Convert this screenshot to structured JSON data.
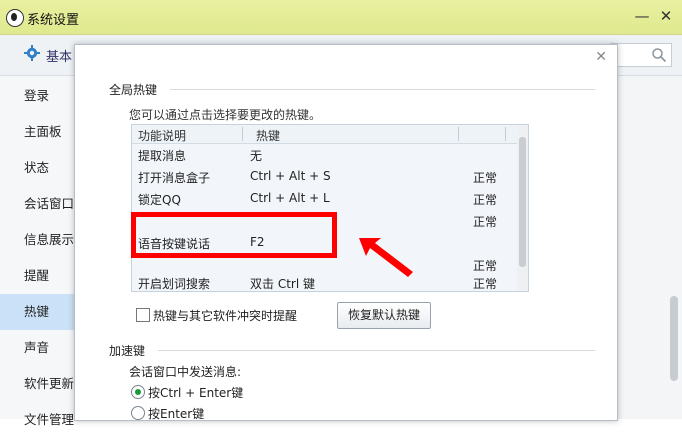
{
  "window": {
    "title": "系统设置",
    "minimize_icon": "minimize-icon",
    "close_icon": "close-icon"
  },
  "toolbar": {
    "tab_label": "基本",
    "search_placeholder": ""
  },
  "sidebar": {
    "items": [
      "登录",
      "主面板",
      "状态",
      "会话窗口",
      "信息展示",
      "提醒",
      "热键",
      "声音",
      "软件更新",
      "文件管理"
    ],
    "active_index": 6
  },
  "hotkeys": {
    "section_title": "全局热键",
    "hint": "您可以通过点击选择要更改的热键。",
    "columns": [
      "功能说明",
      "热键"
    ],
    "rows": [
      {
        "name": "提取消息",
        "key": "无",
        "status": ""
      },
      {
        "name": "打开消息盒子",
        "key": "Ctrl + Alt + S",
        "status": "正常"
      },
      {
        "name": "锁定QQ",
        "key": "Ctrl + Alt + L",
        "status": "正常"
      },
      {
        "name": "",
        "key": "",
        "status": "正常"
      },
      {
        "name": "语音按键说话",
        "key": "F2",
        "status": ""
      },
      {
        "name": "",
        "key": "",
        "status": "正常"
      },
      {
        "name": "开启划词搜索",
        "key": "双击 Ctrl 键",
        "status": "正常"
      }
    ],
    "conflict_checkbox_label": "热键与其它软件冲突时提醒",
    "restore_button": "恢复默认热键"
  },
  "accel": {
    "section_title": "加速键",
    "subtitle": "会话窗口中发送消息:",
    "options": [
      "按Ctrl + Enter键",
      "按Enter键"
    ],
    "selected_index": 0
  },
  "colors": {
    "highlight_red": "#ff0000",
    "active_sidebar": "#cbe1f7",
    "title_bar": "#e4ed98"
  }
}
